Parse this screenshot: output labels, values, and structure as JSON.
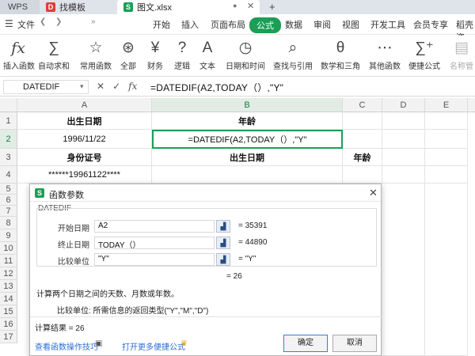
{
  "tabs": {
    "wps": "WPS",
    "template": "找模板",
    "file": "图文.xlsx",
    "new_tab": "+"
  },
  "menu": [
    "文件",
    "开始",
    "插入",
    "页面布局",
    "公式",
    "数据",
    "审阅",
    "视图",
    "开发工具",
    "会员专享",
    "稻壳资"
  ],
  "ribbon": [
    {
      "label": "插入函数",
      "icon": "fx-icon"
    },
    {
      "label": "自动求和",
      "icon": "sum-icon"
    },
    {
      "label": "常用函数",
      "icon": "star-icon"
    },
    {
      "label": "全部",
      "icon": "all-functions-icon"
    },
    {
      "label": "财务",
      "icon": "yen-icon"
    },
    {
      "label": "逻辑",
      "icon": "question-icon"
    },
    {
      "label": "文本",
      "icon": "text-icon"
    },
    {
      "label": "日期和时间",
      "icon": "clock-icon"
    },
    {
      "label": "查找与引用",
      "icon": "search-icon"
    },
    {
      "label": "数学和三角",
      "icon": "theta-icon"
    },
    {
      "label": "其他函数",
      "icon": "more-icon"
    },
    {
      "label": "便捷公式",
      "icon": "sigma-plus-icon"
    },
    {
      "label": "名称管",
      "icon": "name-manager-icon"
    }
  ],
  "formula_bar": {
    "name_box": "DATEDIF",
    "fx": "fx",
    "formula": "=DATEDIF(A2,TODAY（）,\"Y\""
  },
  "columns": [
    "A",
    "B",
    "C",
    "D",
    "E"
  ],
  "rows": [
    "1",
    "2",
    "3",
    "4",
    "5",
    "6",
    "7",
    "8",
    "9",
    "10",
    "11",
    "12",
    "13",
    "14",
    "15",
    "16",
    "17"
  ],
  "cells": {
    "a1": "出生日期",
    "b1": "年龄",
    "a2": "1996/11/22",
    "b2": "=DATEDIF(A2,TODAY（）,\"Y\"",
    "a3": "身份证号",
    "b3": "出生日期",
    "c3": "年龄",
    "a4": "******19961122****"
  },
  "dialog": {
    "title": "函数参数",
    "function_name": "DATEDIF",
    "args": [
      {
        "label": "开始日期",
        "value": "A2",
        "result": "= 35391"
      },
      {
        "label": "终止日期",
        "value": "TODAY（）",
        "result": "= 44890"
      },
      {
        "label": "比较单位",
        "value": "\"Y\"",
        "result": "= \"Y\""
      }
    ],
    "formula_result": "= 26",
    "description": "计算两个日期之间的天数、月数或年数。",
    "arg_help": "比较单位:  所需信息的返回类型(\"Y\",\"M\",\"D\")",
    "calc_result": "计算结果 = 26",
    "help_link": "查看函数操作技巧",
    "more_link": "打开更多便捷公式",
    "ok": "确定",
    "cancel": "取消"
  }
}
